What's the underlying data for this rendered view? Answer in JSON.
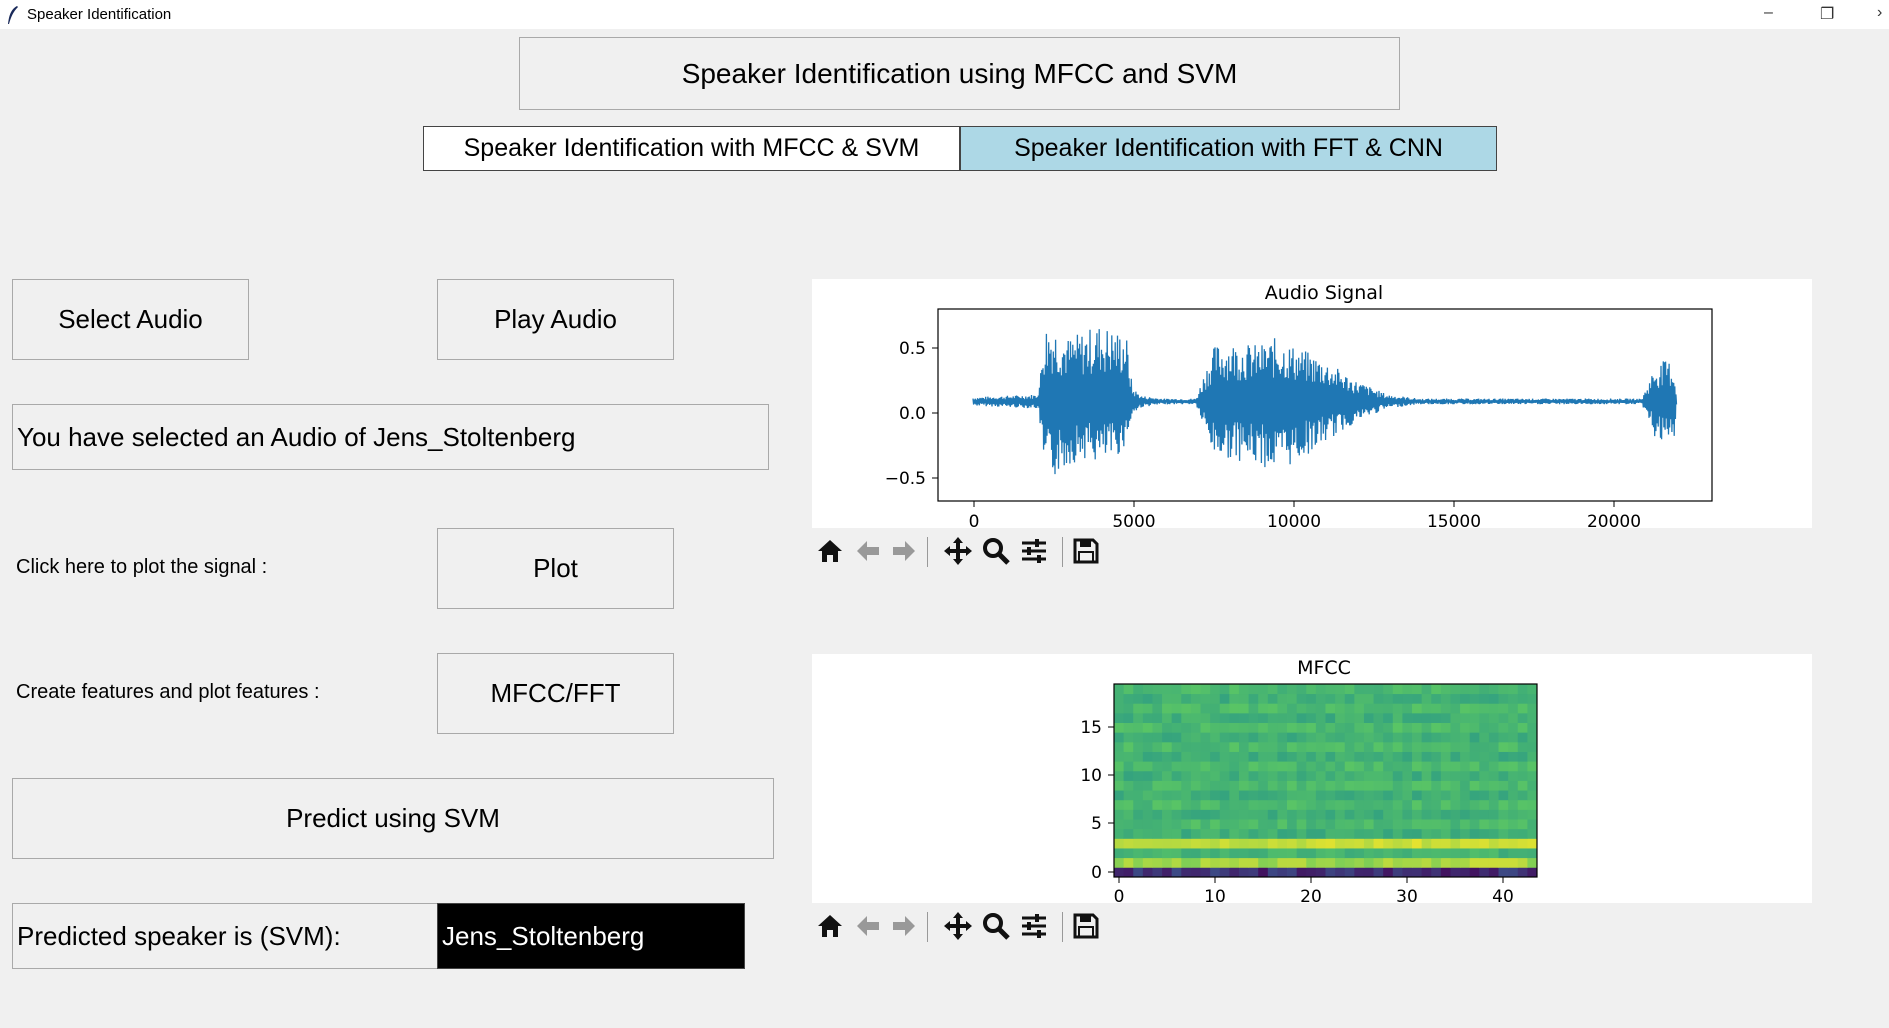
{
  "window": {
    "title": "Speaker Identification",
    "minimize": "–",
    "restore": "❐",
    "close": "›"
  },
  "header": {
    "title": "Speaker Identification using MFCC and SVM"
  },
  "tabs": [
    {
      "label": "Speaker Identification with MFCC & SVM",
      "active": true
    },
    {
      "label": "Speaker Identification with FFT & CNN",
      "active": false,
      "color": "#add8e6"
    }
  ],
  "controls": {
    "select_audio": "Select Audio",
    "play_audio": "Play Audio",
    "selected_message": "You have selected an Audio of Jens_Stoltenberg",
    "plot_prompt": "Click here to plot the signal :",
    "plot_button": "Plot",
    "features_prompt": "Create features and plot features :",
    "features_button": "MFCC/FFT",
    "predict_button": "Predict using SVM",
    "predicted_label": "Predicted speaker is (SVM):",
    "predicted_value": "Jens_Stoltenberg"
  },
  "audio_plot": {
    "title": "Audio Signal",
    "xticks": [
      "0",
      "5000",
      "10000",
      "15000",
      "20000"
    ],
    "yticks": [
      "0.5",
      "0.0",
      "−0.5"
    ]
  },
  "mfcc_plot": {
    "title": "MFCC",
    "xticks": [
      "0",
      "10",
      "20",
      "30",
      "40"
    ],
    "yticks": [
      "15",
      "10",
      "5",
      "0"
    ]
  },
  "toolbar_icons": [
    "home-icon",
    "back-arrow-icon",
    "forward-arrow-icon",
    "pan-icon",
    "zoom-icon",
    "subplots-icon",
    "save-icon"
  ],
  "chart_data": [
    {
      "type": "line",
      "title": "Audio Signal",
      "xlabel": "",
      "ylabel": "",
      "xlim": [
        -1100,
        23200
      ],
      "ylim": [
        -0.7,
        0.65
      ],
      "color": "#1f77b4",
      "envelope": {
        "x": [
          0,
          2000,
          2100,
          2200,
          2300,
          2500,
          3000,
          3500,
          4000,
          4500,
          4800,
          5000,
          5300,
          6000,
          7000,
          7400,
          7600,
          8000,
          9000,
          9500,
          10000,
          11000,
          12000,
          13000,
          14000,
          15000,
          18000,
          21000,
          21400,
          21800,
          22000,
          22100
        ],
        "upper": [
          0.03,
          0.05,
          0.15,
          0.45,
          0.55,
          0.55,
          0.45,
          0.5,
          0.55,
          0.5,
          0.5,
          0.1,
          0.04,
          0.02,
          0.02,
          0.3,
          0.4,
          0.42,
          0.4,
          0.45,
          0.4,
          0.3,
          0.15,
          0.05,
          0.02,
          0.02,
          0.02,
          0.02,
          0.25,
          0.3,
          0.25,
          0.0
        ],
        "lower": [
          -0.03,
          -0.05,
          -0.15,
          -0.5,
          -0.55,
          -0.55,
          -0.45,
          -0.4,
          -0.45,
          -0.4,
          -0.3,
          -0.1,
          -0.04,
          -0.02,
          -0.02,
          -0.3,
          -0.4,
          -0.4,
          -0.45,
          -0.5,
          -0.45,
          -0.3,
          -0.15,
          -0.05,
          -0.02,
          -0.02,
          -0.02,
          -0.02,
          -0.25,
          -0.35,
          -0.3,
          0.0
        ]
      }
    },
    {
      "type": "heatmap",
      "title": "MFCC",
      "xlabel": "",
      "ylabel": "",
      "xlim": [
        0,
        44
      ],
      "ylim": [
        -0.5,
        19.5
      ],
      "rows": 20,
      "cols": 44,
      "colormap": "viridis"
    }
  ]
}
